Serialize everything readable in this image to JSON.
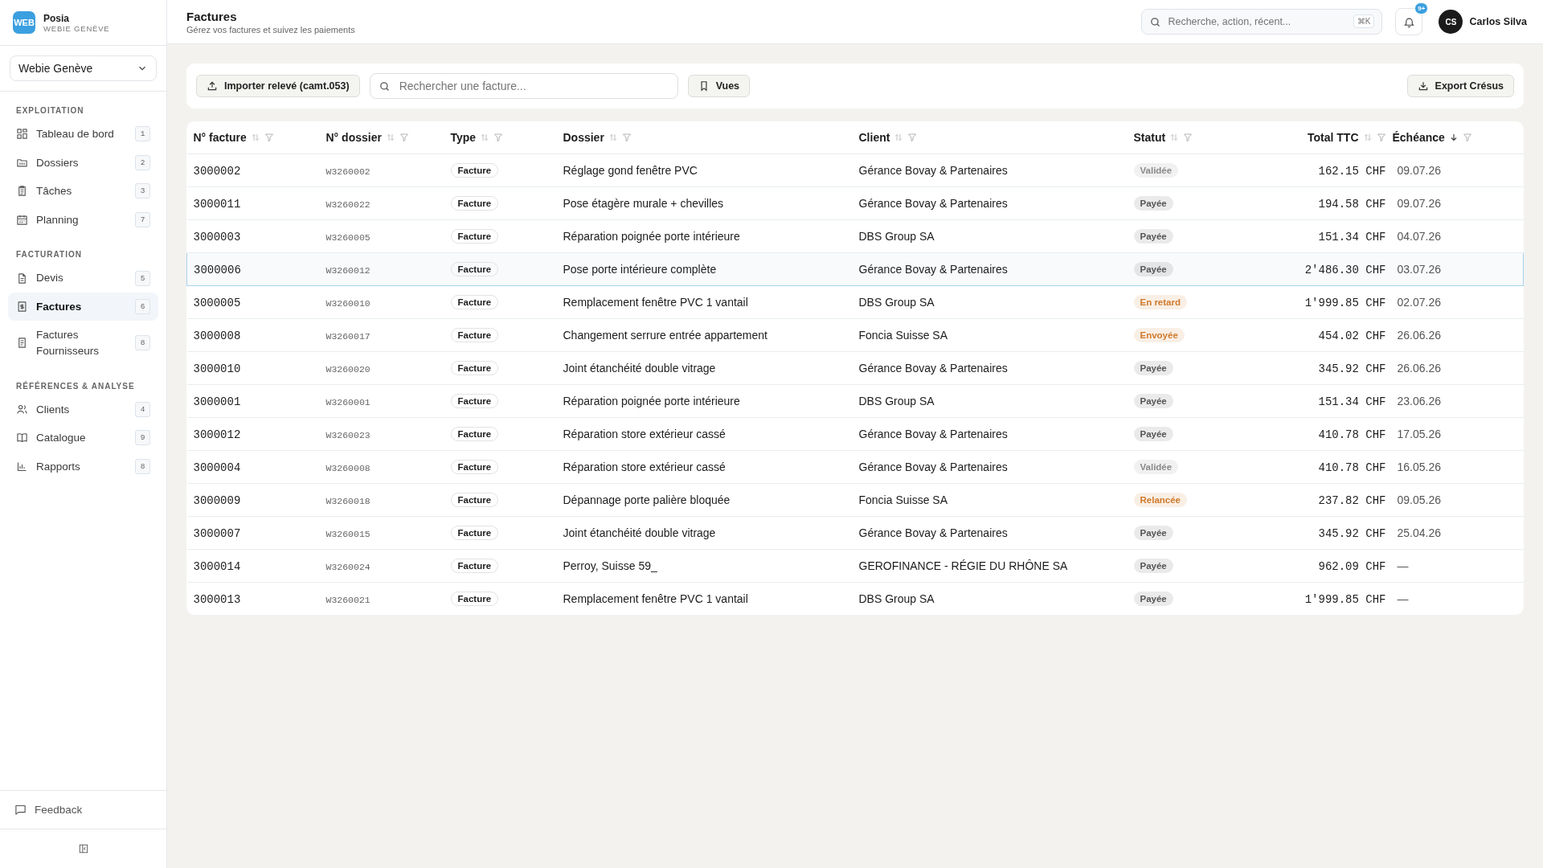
{
  "brand": {
    "logo": "WEB",
    "name": "Posia",
    "subtitle": "WEBIE GENÈVE"
  },
  "workspace": {
    "value": "Webie Genève"
  },
  "sidebar": {
    "sections": [
      {
        "title": "EXPLOITATION",
        "items": [
          {
            "label": "Tableau de bord",
            "badge": "1",
            "selected": false
          },
          {
            "label": "Dossiers",
            "badge": "2",
            "selected": false
          },
          {
            "label": "Tâches",
            "badge": "3",
            "selected": false
          },
          {
            "label": "Planning",
            "badge": "7",
            "selected": false
          }
        ]
      },
      {
        "title": "FACTURATION",
        "items": [
          {
            "label": "Devis",
            "badge": "5",
            "selected": false
          },
          {
            "label": "Factures",
            "badge": "6",
            "selected": true
          },
          {
            "label": "Factures Fournisseurs",
            "badge": "8",
            "selected": false
          }
        ]
      },
      {
        "title": "RÉFÉRENCES & ANALYSE",
        "items": [
          {
            "label": "Clients",
            "badge": "4",
            "selected": false
          },
          {
            "label": "Catalogue",
            "badge": "9",
            "selected": false
          },
          {
            "label": "Rapports",
            "badge": "8",
            "selected": false
          }
        ]
      }
    ],
    "feedback": "Feedback"
  },
  "header": {
    "title": "Factures",
    "subtitle": "Gérez vos factures et suivez les paiements",
    "search_placeholder": "Recherche, action, récent...",
    "shortcut": "⌘K",
    "notification_count": "9+",
    "user_initials": "CS",
    "user_name": "Carlos Silva"
  },
  "toolbar": {
    "import_button": "Importer relevé (camt.053)",
    "search_placeholder": "Rechercher une facture...",
    "views_button": "Vues",
    "export_button": "Export Crésus"
  },
  "table": {
    "columns": [
      {
        "label": "N° facture",
        "kind": "mono",
        "sorted": false
      },
      {
        "label": "N° dossier",
        "kind": "code",
        "sorted": false
      },
      {
        "label": "Type",
        "kind": "tag",
        "sorted": false
      },
      {
        "label": "Dossier",
        "kind": "text",
        "sorted": false
      },
      {
        "label": "Client",
        "kind": "text",
        "sorted": false
      },
      {
        "label": "Statut",
        "kind": "status",
        "sorted": false
      },
      {
        "label": "Total TTC",
        "kind": "amount",
        "sorted": false
      },
      {
        "label": "Échéance",
        "kind": "date",
        "sorted": true
      }
    ],
    "rows": [
      {
        "selected": false,
        "cells": [
          "3000002",
          "W3260002",
          "Facture",
          "Réglage gond fenêtre PVC",
          "Gérance Bovay & Partenaires",
          "Validée",
          "162.15 CHF",
          "09.07.26"
        ],
        "color": "#8a8a8a"
      },
      {
        "selected": false,
        "cells": [
          "3000011",
          "W3260022",
          "Facture",
          "Pose étagère murale + chevilles",
          "Gérance Bovay & Partenaires",
          "Payée",
          "194.58 CHF",
          "09.07.26"
        ],
        "color": "#555555"
      },
      {
        "selected": false,
        "cells": [
          "3000003",
          "W3260005",
          "Facture",
          "Réparation poignée porte intérieure",
          "DBS Group SA",
          "Payée",
          "151.34 CHF",
          "04.07.26"
        ],
        "color": "#555555"
      },
      {
        "selected": true,
        "cells": [
          "3000006",
          "W3260012",
          "Facture",
          "Pose porte intérieure complète",
          "Gérance Bovay & Partenaires",
          "Payée",
          "2'486.30 CHF",
          "03.07.26"
        ],
        "color": "#555555"
      },
      {
        "selected": false,
        "cells": [
          "3000005",
          "W3260010",
          "Facture",
          "Remplacement fenêtre PVC 1 vantail",
          "DBS Group SA",
          "En retard",
          "1'999.85 CHF",
          "02.07.26"
        ],
        "color": "#d07a2c"
      },
      {
        "selected": false,
        "cells": [
          "3000008",
          "W3260017",
          "Facture",
          "Changement serrure entrée appartement",
          "Foncia Suisse SA",
          "Envoyée",
          "454.02 CHF",
          "26.06.26"
        ],
        "color": "#d07a2c"
      },
      {
        "selected": false,
        "cells": [
          "3000010",
          "W3260020",
          "Facture",
          "Joint étanchéité double vitrage",
          "Gérance Bovay & Partenaires",
          "Payée",
          "345.92 CHF",
          "26.06.26"
        ],
        "color": "#555555"
      },
      {
        "selected": false,
        "cells": [
          "3000001",
          "W3260001",
          "Facture",
          "Réparation poignée porte intérieure",
          "DBS Group SA",
          "Payée",
          "151.34 CHF",
          "23.06.26"
        ],
        "color": "#555555"
      },
      {
        "selected": false,
        "cells": [
          "3000012",
          "W3260023",
          "Facture",
          "Réparation store extérieur cassé",
          "Gérance Bovay & Partenaires",
          "Payée",
          "410.78 CHF",
          "17.05.26"
        ],
        "color": "#555555"
      },
      {
        "selected": false,
        "cells": [
          "3000004",
          "W3260008",
          "Facture",
          "Réparation store extérieur cassé",
          "Gérance Bovay & Partenaires",
          "Validée",
          "410.78 CHF",
          "16.05.26"
        ],
        "color": "#8a8a8a"
      },
      {
        "selected": false,
        "cells": [
          "3000009",
          "W3260018",
          "Facture",
          "Dépannage porte palière bloquée",
          "Foncia Suisse SA",
          "Relancée",
          "237.82 CHF",
          "09.05.26"
        ],
        "color": "#d07a2c"
      },
      {
        "selected": false,
        "cells": [
          "3000007",
          "W3260015",
          "Facture",
          "Joint étanchéité double vitrage",
          "Gérance Bovay & Partenaires",
          "Payée",
          "345.92 CHF",
          "25.04.26"
        ],
        "color": "#555555"
      },
      {
        "selected": false,
        "cells": [
          "3000014",
          "W3260024",
          "Facture",
          "Perroy, Suisse 59_",
          "GEROFINANCE - RÉGIE DU RHÔNE SA",
          "Payée",
          "962.09 CHF",
          "—"
        ],
        "color": "#555555"
      },
      {
        "selected": false,
        "cells": [
          "3000013",
          "W3260021",
          "Facture",
          "Remplacement fenêtre PVC 1 vantail",
          "DBS Group SA",
          "Payée",
          "1'999.85 CHF",
          "—"
        ],
        "color": "#555555"
      }
    ]
  }
}
